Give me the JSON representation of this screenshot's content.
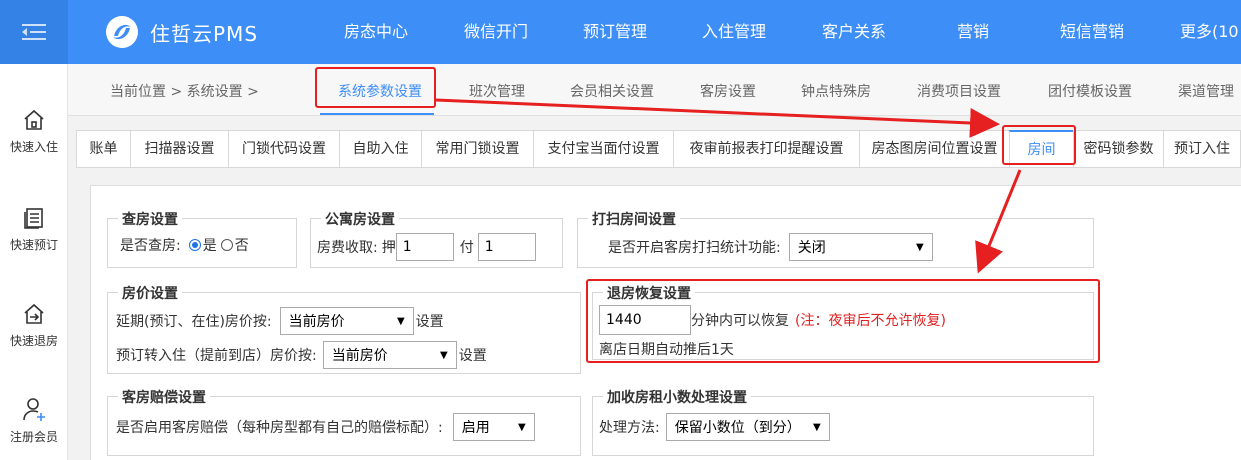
{
  "header": {
    "brand": "住哲云PMS",
    "nav": [
      "房态中心",
      "微信开门",
      "预订管理",
      "入住管理",
      "客户关系",
      "营销",
      "短信营销",
      "更多(10"
    ]
  },
  "sidebar": {
    "items": [
      {
        "label": "快速入住",
        "icon": "house-icon"
      },
      {
        "label": "快速预订",
        "icon": "document-list-icon"
      },
      {
        "label": "快速退房",
        "icon": "exit-house-icon"
      },
      {
        "label": "注册会员",
        "icon": "add-user-icon"
      }
    ]
  },
  "breadcrumb": {
    "text": "当前位置 > 系统设置 >"
  },
  "tabs": [
    "系统参数设置",
    "班次管理",
    "会员相关设置",
    "客房设置",
    "钟点特殊房",
    "消费项目设置",
    "团付模板设置",
    "渠道管理"
  ],
  "subtabs": [
    "账单",
    "扫描器设置",
    "门锁代码设置",
    "自助入住",
    "常用门锁设置",
    "支付宝当面付设置",
    "夜审前报表打印提醒设置",
    "房态图房间位置设置",
    "房间",
    "密码锁参数",
    "预订入住"
  ],
  "checkroom": {
    "title": "查房设置",
    "label": "是否查房:",
    "yes": "是",
    "no": "否"
  },
  "apartment": {
    "title": "公寓房设置",
    "label": "房费收取:",
    "deposit_label": "押",
    "deposit_value": "1",
    "pay_label": "付",
    "pay_value": "1"
  },
  "cleaning": {
    "title": "打扫房间设置",
    "label": "是否开启客房打扫统计功能:",
    "value": "关闭"
  },
  "price": {
    "title": "房价设置",
    "row1_label": "延期(预订、在住)房价按:",
    "row1_value": "当前房价",
    "row1_suffix": "设置",
    "row2_label": "预订转入住（提前到店）房价按:",
    "row2_value": "当前房价",
    "row2_suffix": "设置"
  },
  "restore": {
    "title": "退房恢复设置",
    "minutes_value": "1440",
    "minutes_suffix": "分钟内可以恢复",
    "note": "(注：夜审后不允许恢复)",
    "auto_text": "离店日期自动推后1天"
  },
  "compensation": {
    "title": "客房赔偿设置",
    "label": "是否启用客房赔偿（每种房型都有自己的赔偿标配）:",
    "value": "启用"
  },
  "decimal": {
    "title": "加收房租小数处理设置",
    "label": "处理方法:",
    "value": "保留小数位（到分）"
  },
  "colors": {
    "primary": "#3e8ef7",
    "highlight": "#e62020",
    "note": "#e02020"
  }
}
